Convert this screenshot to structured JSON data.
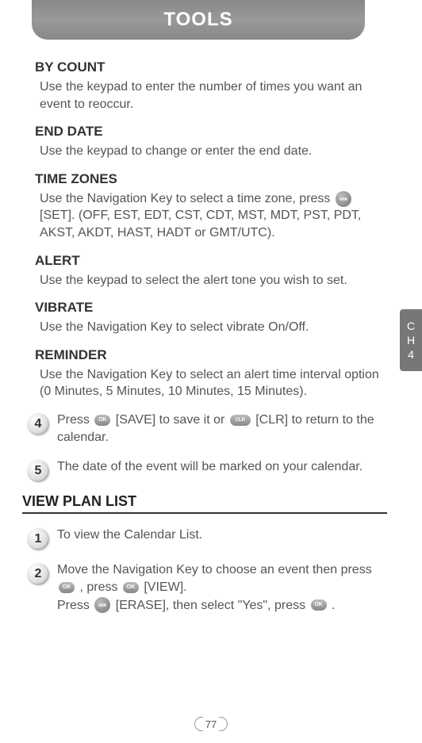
{
  "header": {
    "title": "TOOLS"
  },
  "side_tab": {
    "line1": "C",
    "line2": "H",
    "line3": "4"
  },
  "sections": {
    "by_count": {
      "title": "BY COUNT",
      "body": "Use the keypad to enter the number of times you want an event to reoccur."
    },
    "end_date": {
      "title": "END DATE",
      "body": "Use the keypad to change or enter the end date."
    },
    "time_zones": {
      "title": "TIME ZONES",
      "body_pre": "Use the Navigation Key to select a time zone, press ",
      "body_post": " [SET]. (OFF, EST, EDT, CST, CDT, MST, MDT, PST, PDT, AKST, AKDT, HAST, HADT or GMT/UTC)."
    },
    "alert": {
      "title": "ALERT",
      "body": "Use the keypad to select the alert tone you wish to set."
    },
    "vibrate": {
      "title": "VIBRATE",
      "body": "Use the Navigation Key to select vibrate On/Off."
    },
    "reminder": {
      "title": "REMINDER",
      "body": "Use the Navigation Key to select an alert time interval option (0 Minutes, 5 Minutes, 10 Minutes, 15 Minutes)."
    }
  },
  "steps_a": {
    "s4": {
      "num": "4",
      "t1": "Press ",
      "t2": " [SAVE] to save it or ",
      "t3": " [CLR] to return to the calendar."
    },
    "s5": {
      "num": "5",
      "text": "The date of the event will be marked on your calendar."
    }
  },
  "view_plan": {
    "title": "VIEW PLAN LIST",
    "s1": {
      "num": "1",
      "text": "To view the Calendar List."
    },
    "s2": {
      "num": "2",
      "t1": "Move the Navigation Key to choose an event then press ",
      "t2": " , press ",
      "t3": " [VIEW].",
      "t4": "Press ",
      "t5": " [ERASE], then select \"Yes\", press ",
      "t6": " ."
    }
  },
  "icons": {
    "ok": "OK",
    "clr": "CLR"
  },
  "page": {
    "num": "77"
  }
}
